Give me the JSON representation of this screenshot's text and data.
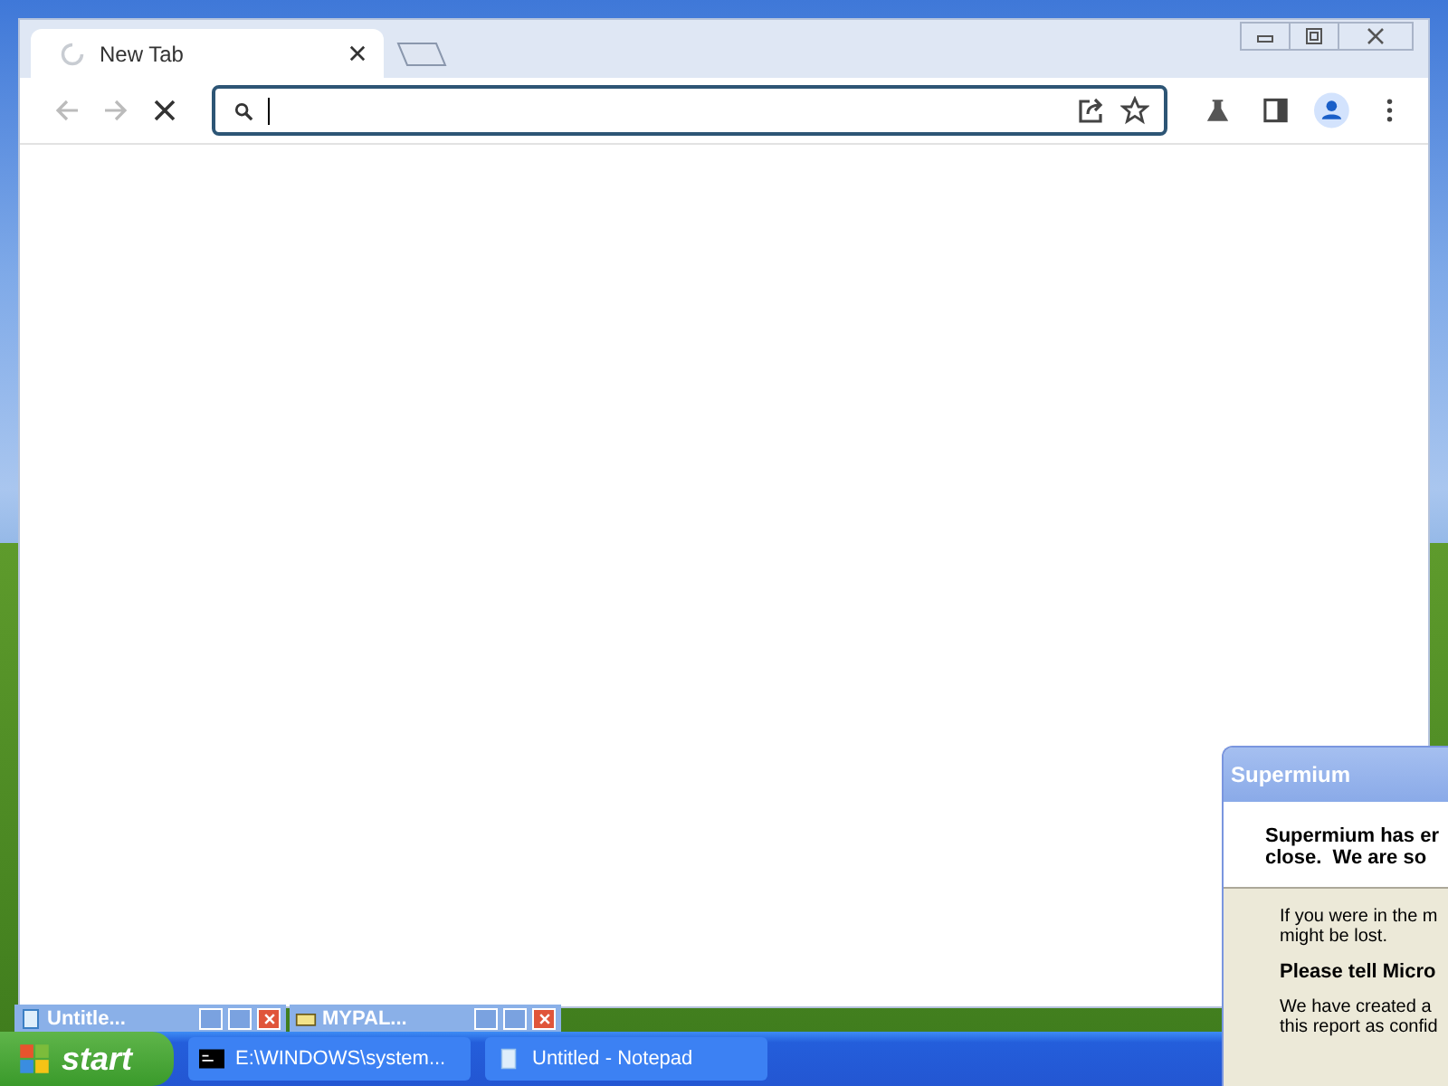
{
  "browser": {
    "tabs": [
      {
        "title": "New Tab",
        "selected": true
      }
    ],
    "nav": [
      {
        "kind": "back",
        "disabled": true
      },
      {
        "kind": "forward",
        "disabled": true
      },
      {
        "kind": "stop",
        "disabled": false
      }
    ]
  },
  "minimized_windows": [
    {
      "title": "Untitle...",
      "kind": "notepad"
    },
    {
      "title": "MYPAL...",
      "kind": "mypal"
    }
  ],
  "taskbar": {
    "start": "start",
    "tasks": [
      {
        "title": "E:\\WINDOWS\\system...",
        "kind": "console"
      },
      {
        "title": "Untitled - Notepad",
        "kind": "notepad"
      }
    ]
  },
  "dialog": {
    "title": "Supermium",
    "header_lines": [
      "Supermium has er",
      "close.  We are so"
    ],
    "body": [
      {
        "kind": "text",
        "lines": [
          "If you were in the m",
          "might be lost."
        ]
      },
      {
        "kind": "heading",
        "lines": [
          "Please tell Micro"
        ]
      },
      {
        "kind": "text",
        "lines": [
          "We have created a",
          "this report as confid"
        ]
      }
    ]
  }
}
